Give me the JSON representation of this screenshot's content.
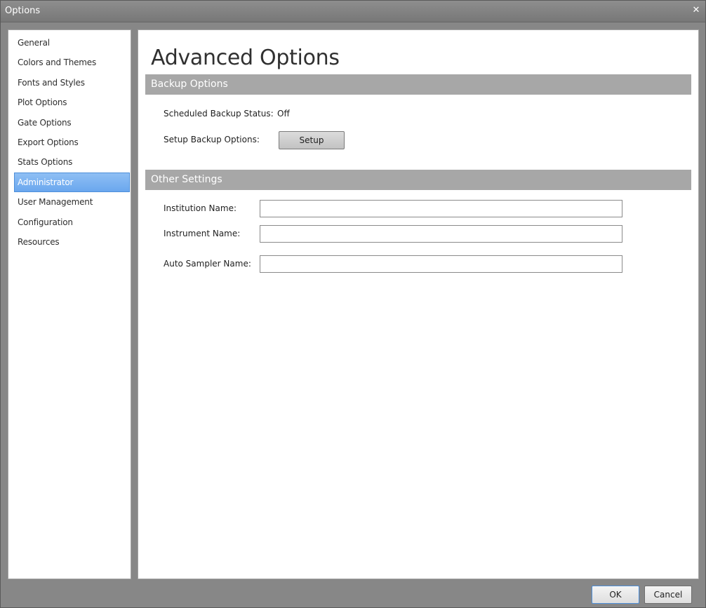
{
  "window": {
    "title": "Options",
    "close_glyph": "✕"
  },
  "sidebar": {
    "items": [
      {
        "label": "General"
      },
      {
        "label": "Colors and Themes"
      },
      {
        "label": "Fonts and Styles"
      },
      {
        "label": "Plot Options"
      },
      {
        "label": "Gate Options"
      },
      {
        "label": "Export Options"
      },
      {
        "label": "Stats Options"
      },
      {
        "label": "Administrator"
      },
      {
        "label": "User Management"
      },
      {
        "label": "Configuration"
      },
      {
        "label": "Resources"
      }
    ],
    "selected": "Administrator"
  },
  "main": {
    "title": "Advanced Options",
    "backup": {
      "header": "Backup Options",
      "status_label": "Scheduled Backup Status:",
      "status_value": "Off",
      "setup_label": "Setup Backup Options:",
      "setup_button": "Setup"
    },
    "other": {
      "header": "Other Settings",
      "institution_label": "Institution Name:",
      "institution_value": "",
      "instrument_label": "Instrument Name:",
      "instrument_value": "",
      "autosampler_label": "Auto Sampler Name:",
      "autosampler_value": ""
    }
  },
  "footer": {
    "ok_label": "OK",
    "cancel_label": "Cancel"
  },
  "colors": {
    "accent": "#6aa7ee",
    "section_header": "#a7a7a7",
    "window_frame": "#878787"
  }
}
